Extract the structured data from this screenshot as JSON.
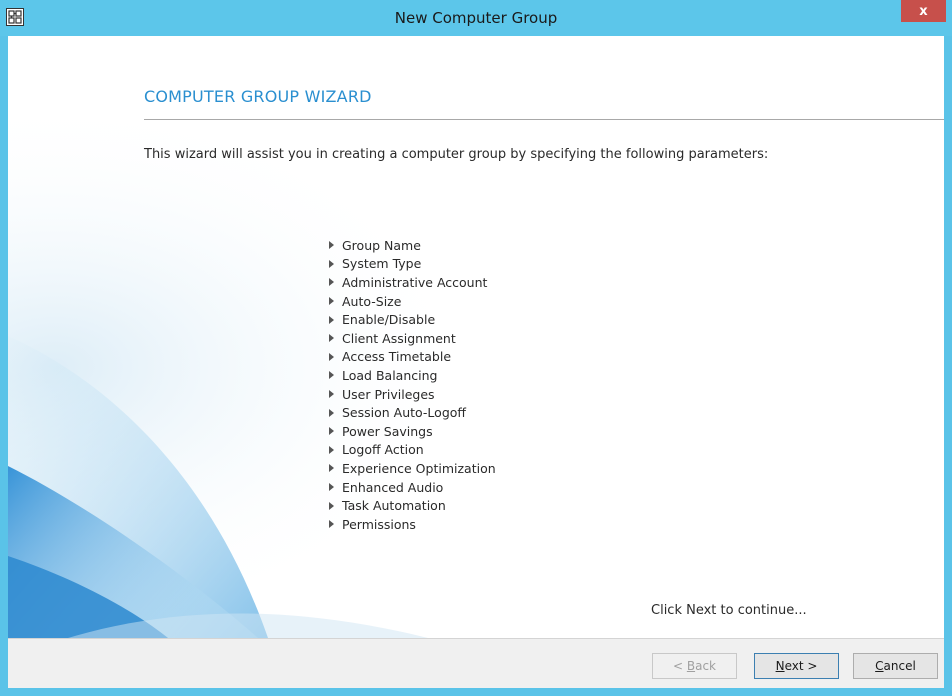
{
  "window": {
    "title": "New Computer Group",
    "close_label": "x"
  },
  "wizard": {
    "heading": "COMPUTER GROUP WIZARD",
    "intro": "This wizard will assist you in creating a computer group by specifying the following parameters:",
    "parameters": [
      "Group Name",
      "System Type",
      "Administrative Account",
      "Auto-Size",
      "Enable/Disable",
      "Client Assignment",
      "Access Timetable",
      "Load Balancing",
      "User Privileges",
      "Session Auto-Logoff",
      "Power Savings",
      "Logoff Action",
      "Experience Optimization",
      "Enhanced Audio",
      "Task Automation",
      "Permissions"
    ],
    "continue_text": "Click Next to continue..."
  },
  "buttons": {
    "back": {
      "prefix": "< ",
      "mnemonic": "B",
      "rest": "ack",
      "enabled": false
    },
    "next": {
      "mnemonic": "N",
      "rest": "ext >",
      "enabled": true
    },
    "cancel": {
      "mnemonic": "C",
      "rest": "ancel",
      "enabled": true
    }
  },
  "colors": {
    "titlebar": "#5cc6ea",
    "heading": "#2a8fd0",
    "close": "#c7504b"
  }
}
